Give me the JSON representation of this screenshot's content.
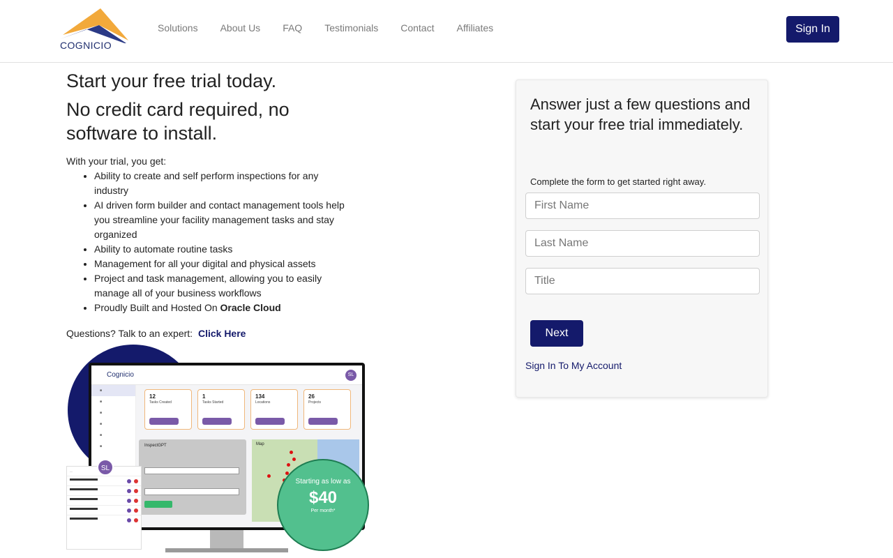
{
  "nav": {
    "logo_text": "COGNICIO",
    "links": [
      "Solutions",
      "About Us",
      "FAQ",
      "Testimonials",
      "Contact",
      "Affiliates"
    ],
    "signin_label": "Sign In"
  },
  "hero": {
    "title": "Start your free trial today.",
    "subtitle": "No credit card required, no software to install.",
    "intro": "With your trial, you get:",
    "benefits": [
      "Ability to create and self perform inspections for any industry",
      "AI driven form builder and contact management tools help you streamline your facility management tasks and stay organized",
      "Ability to automate routine tasks",
      "Management for all your digital and physical assets",
      "Project and task management, allowing you to easily manage all of your business workflows"
    ],
    "oracle_prefix": "Proudly Built and Hosted On ",
    "oracle_bold": "Oracle Cloud",
    "questions_text": "Questions? Talk to an expert: ",
    "click_here": "Click Here"
  },
  "product_image": {
    "app_name": "Cognicio",
    "avatar_initials": "SL",
    "cards": [
      {
        "num": "12",
        "label": "Tasks Created"
      },
      {
        "num": "1",
        "label": "Tasks Started"
      },
      {
        "num": "134",
        "label": "Locations"
      },
      {
        "num": "26",
        "label": "Projects"
      }
    ],
    "gpt_title": "InspectGPT",
    "map_tab": "Map",
    "price_line1": "Starting as low as",
    "price_amount": "$40",
    "price_period": "Per month*"
  },
  "form": {
    "title": "Answer just a few questions and start your free trial immediately.",
    "subtitle": "Complete the form to get started right away.",
    "first_name_placeholder": "First Name",
    "last_name_placeholder": "Last Name",
    "title_placeholder": "Title",
    "next_label": "Next",
    "account_link": "Sign In To My Account"
  },
  "colors": {
    "brand_navy": "#141a6b",
    "price_green": "#52c08e",
    "logo_orange": "#f2a93b"
  }
}
